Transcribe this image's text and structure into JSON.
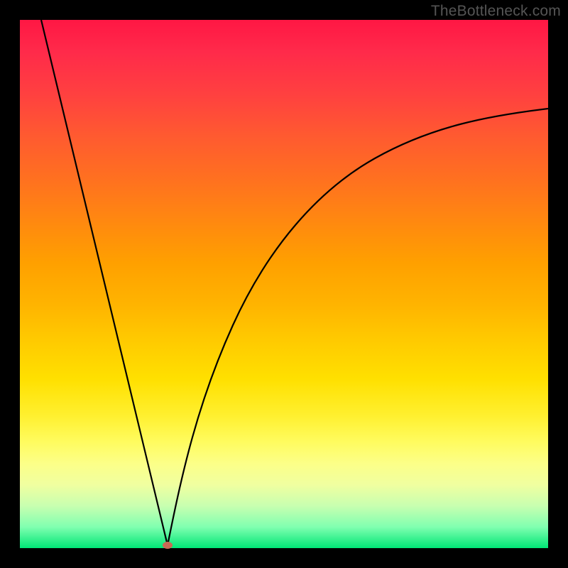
{
  "watermark": "TheBottleneck.com",
  "chart_data": {
    "type": "line",
    "title": "",
    "xlabel": "",
    "ylabel": "",
    "xlim": [
      0,
      100
    ],
    "ylim": [
      0,
      100
    ],
    "grid": false,
    "legend": false,
    "series": [
      {
        "name": "left-branch",
        "x": [
          4,
          8,
          12,
          16,
          20,
          24,
          28
        ],
        "values": [
          100,
          83,
          66,
          49,
          32,
          15,
          0
        ]
      },
      {
        "name": "right-branch",
        "x": [
          28,
          30,
          33,
          36,
          40,
          45,
          52,
          60,
          70,
          82,
          100
        ],
        "values": [
          0,
          11,
          23,
          33,
          43,
          52,
          60,
          67,
          73,
          78,
          83
        ]
      }
    ],
    "marker": {
      "x": 28,
      "y": 0,
      "color": "#c96a55"
    },
    "background_gradient": {
      "top": "#ff1744",
      "mid": "#ffc800",
      "bottom": "#00e676"
    }
  }
}
